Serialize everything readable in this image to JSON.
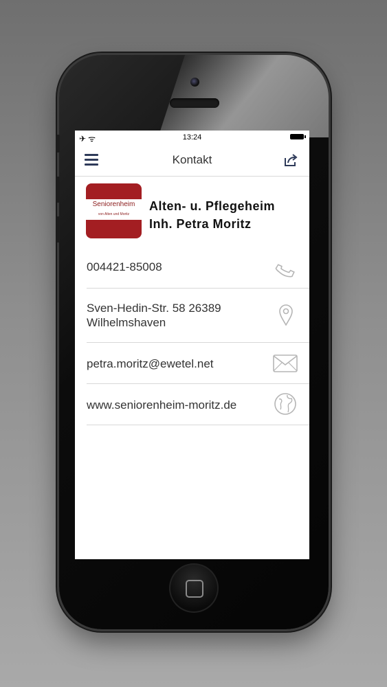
{
  "status_bar": {
    "time": "13:24",
    "airplane_icon": "airplane-icon",
    "wifi_icon": "wifi-icon",
    "battery_icon": "battery-icon"
  },
  "nav": {
    "title": "Kontakt",
    "menu_icon": "menu-icon",
    "share_icon": "share-icon"
  },
  "logo": {
    "main_text": "Seniorenheim",
    "sub_text": "von Alten und Moritz",
    "color": "#a31e22"
  },
  "business": {
    "name_line1": "Alten- u. Pflegeheim",
    "name_line2": "Inh. Petra Moritz"
  },
  "contact": {
    "phone": "004421-85008",
    "address_line1": "Sven-Hedin-Str. 58 26389",
    "address_line2": "Wilhelmshaven",
    "email": "petra.moritz@ewetel.net",
    "website": "www.seniorenheim-moritz.de"
  },
  "icons": {
    "phone": "phone-icon",
    "location": "location-pin-icon",
    "email": "envelope-icon",
    "website": "globe-icon"
  },
  "colors": {
    "accent": "#2e3a59",
    "icon_gray": "#b5b5b5"
  }
}
